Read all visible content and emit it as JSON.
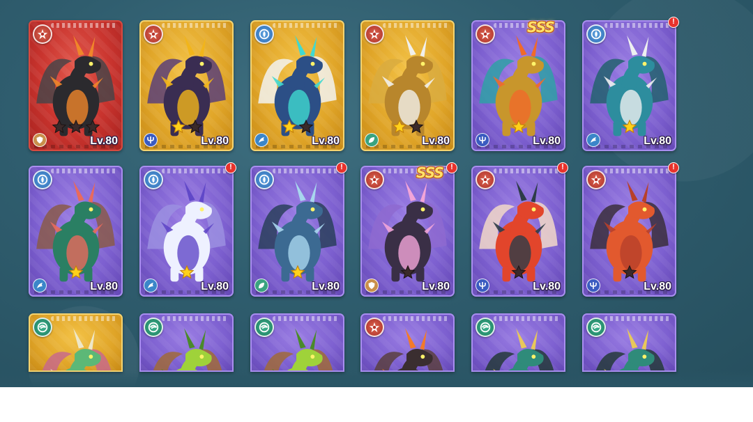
{
  "ui": {
    "colors": {
      "background": "#2f5d6e",
      "card_red": "#c9342e",
      "card_gold": "#e0a528",
      "card_purple": "#7d60d0",
      "star_gold": "#ffd11a",
      "star_empty": "#3a2a2a",
      "alert": "#e8332c"
    }
  },
  "grid": {
    "rows": [
      {
        "cards": [
          {
            "art": "dark-volcanic-dragon",
            "rarity": "red",
            "element": "fire",
            "role": "tank",
            "stars_filled": 0,
            "stars_total": 3,
            "level": "Lv.80",
            "alert": false,
            "badge": ""
          },
          {
            "art": "obsidian-fire-dragon",
            "rarity": "gold",
            "element": "fire",
            "role": "dps",
            "stars_filled": 1,
            "stars_total": 2,
            "level": "Lv.80",
            "alert": false,
            "badge": ""
          },
          {
            "art": "azure-storm-dragon",
            "rarity": "gold",
            "element": "water",
            "role": "mage",
            "stars_filled": 1,
            "stars_total": 2,
            "level": "Lv.80",
            "alert": false,
            "badge": ""
          },
          {
            "art": "golden-horned-dragon",
            "rarity": "gold",
            "element": "fire",
            "role": "support",
            "stars_filled": 1,
            "stars_total": 2,
            "level": "Lv.80",
            "alert": false,
            "badge": ""
          },
          {
            "art": "golden-armored-dragon",
            "rarity": "purple",
            "element": "fire",
            "role": "dps",
            "stars_filled": 1,
            "stars_total": 1,
            "level": "Lv.80",
            "alert": false,
            "badge": "SSS"
          },
          {
            "art": "teal-sea-dragon",
            "rarity": "purple",
            "element": "water",
            "role": "mage",
            "stars_filled": 1,
            "stars_total": 1,
            "level": "Lv.80",
            "alert": true,
            "badge": ""
          }
        ]
      },
      {
        "cards": [
          {
            "art": "green-serpent-dragon",
            "rarity": "purple",
            "element": "water",
            "role": "mage",
            "stars_filled": 1,
            "stars_total": 1,
            "level": "Lv.80",
            "alert": false,
            "badge": ""
          },
          {
            "art": "white-ice-dragon",
            "rarity": "purple",
            "element": "water",
            "role": "mage",
            "stars_filled": 1,
            "stars_total": 1,
            "level": "Lv.80",
            "alert": true,
            "badge": ""
          },
          {
            "art": "steel-blue-dragon",
            "rarity": "purple",
            "element": "water",
            "role": "support",
            "stars_filled": 1,
            "stars_total": 1,
            "level": "Lv.80",
            "alert": true,
            "badge": ""
          },
          {
            "art": "crystal-spider-dragon",
            "rarity": "purple",
            "element": "fire",
            "role": "tank",
            "stars_filled": 0,
            "stars_total": 1,
            "level": "Lv.80",
            "alert": true,
            "badge": "SSS"
          },
          {
            "art": "crimson-wing-dragon",
            "rarity": "purple",
            "element": "fire",
            "role": "dps",
            "stars_filled": 0,
            "stars_total": 1,
            "level": "Lv.80",
            "alert": true,
            "badge": ""
          },
          {
            "art": "ember-feather-dragon",
            "rarity": "purple",
            "element": "fire",
            "role": "dps",
            "stars_filled": 0,
            "stars_total": 1,
            "level": "Lv.80",
            "alert": true,
            "badge": ""
          }
        ]
      },
      {
        "cards": [
          {
            "art": "forest-antler-dragon",
            "rarity": "gold",
            "element": "wind",
            "partial": true
          },
          {
            "art": "leaf-mane-dragon",
            "rarity": "purple",
            "element": "wind",
            "partial": true
          },
          {
            "art": "leaf-mane-dragon",
            "rarity": "purple",
            "element": "wind",
            "partial": true
          },
          {
            "art": "lava-rock-dragon",
            "rarity": "purple",
            "element": "fire",
            "partial": true
          },
          {
            "art": "jade-wing-dragon",
            "rarity": "purple",
            "element": "wind",
            "partial": true
          },
          {
            "art": "jade-wing-dragon",
            "rarity": "purple",
            "element": "wind",
            "partial": true
          }
        ]
      }
    ]
  }
}
